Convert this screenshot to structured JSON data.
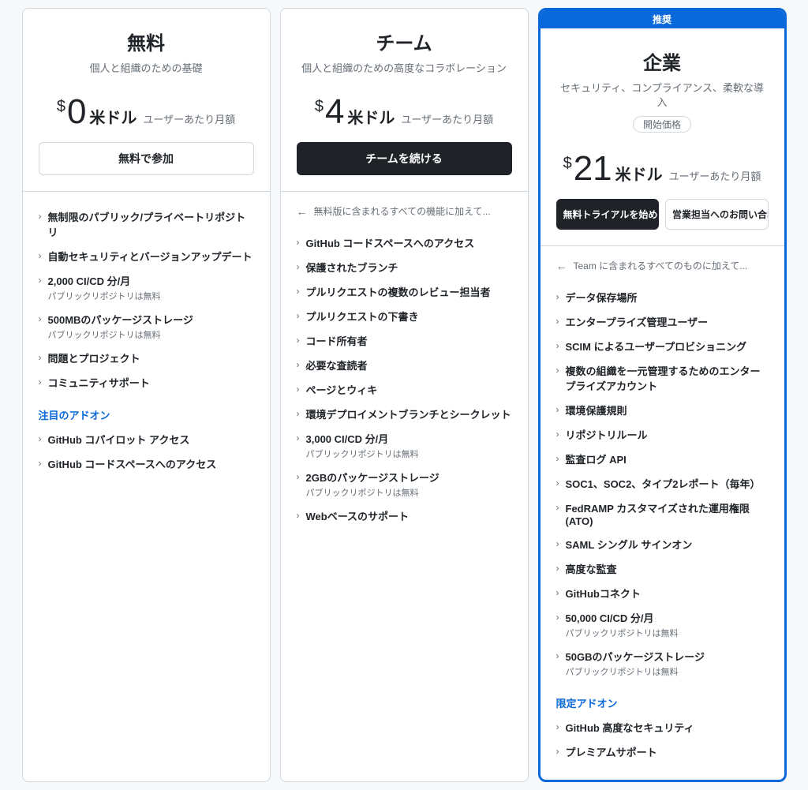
{
  "plans": [
    {
      "name": "無料",
      "desc": "個人と組織のための基礎",
      "price": "0",
      "currency": "米ドル",
      "per": "ユーザーあたり月額",
      "buttons": [
        {
          "label": "無料で参加",
          "style": "light"
        }
      ],
      "inherit": null,
      "features": [
        {
          "main": "無制限のパブリック/プライベートリポジトリ"
        },
        {
          "main": "自動セキュリティとバージョンアップデート"
        },
        {
          "main": "2,000 CI/CD 分/月",
          "sub": "パブリックリポジトリは無料"
        },
        {
          "main": "500MBのパッケージストレージ",
          "sub": "パブリックリポジトリは無料"
        },
        {
          "main": "問題とプロジェクト"
        },
        {
          "main": "コミュニティサポート"
        }
      ],
      "addon_heading": "注目のアドオン",
      "addons": [
        {
          "main": "GitHub コパイロット アクセス"
        },
        {
          "main": "GitHub コードスペースへのアクセス"
        }
      ]
    },
    {
      "name": "チーム",
      "desc": "個人と組織のための高度なコラボレーション",
      "price": "4",
      "currency": "米ドル",
      "per": "ユーザーあたり月額",
      "buttons": [
        {
          "label": "チームを続ける",
          "style": "dark"
        }
      ],
      "inherit": "無料版に含まれるすべての機能に加えて...",
      "features": [
        {
          "main": "GitHub コードスペースへのアクセス"
        },
        {
          "main": "保護されたブランチ"
        },
        {
          "main": "プルリクエストの複数のレビュー担当者"
        },
        {
          "main": "プルリクエストの下書き"
        },
        {
          "main": "コード所有者"
        },
        {
          "main": "必要な査読者"
        },
        {
          "main": "ページとウィキ"
        },
        {
          "main": "環境デプロイメントブランチとシークレット"
        },
        {
          "main": "3,000 CI/CD 分/月",
          "sub": "パブリックリポジトリは無料"
        },
        {
          "main": "2GBのパッケージストレージ",
          "sub": "パブリックリポジトリは無料"
        },
        {
          "main": "Webベースのサポート"
        }
      ],
      "addon_heading": null,
      "addons": []
    },
    {
      "name": "企業",
      "desc": "セキュリティ、コンプライアンス、柔軟な導入",
      "recommended": "推奨",
      "start_price": "開始価格",
      "price": "21",
      "currency": "米ドル",
      "per": "ユーザーあたり月額",
      "buttons": [
        {
          "label": "無料トライアルを始め",
          "style": "dark"
        },
        {
          "label": "営業担当へのお問い合わせ",
          "style": "light"
        }
      ],
      "inherit": "Team に含まれるすべてのものに加えて...",
      "features": [
        {
          "main": "データ保存場所"
        },
        {
          "main": "エンタープライズ管理ユーザー"
        },
        {
          "main": "SCIM によるユーザープロビショニング"
        },
        {
          "main": "複数の組織を一元管理するためのエンタープライズアカウント"
        },
        {
          "main": "環境保護規則"
        },
        {
          "main": "リポジトリルール"
        },
        {
          "main": "監査ログ API"
        },
        {
          "main": "SOC1、SOC2、タイプ2レポート（毎年）"
        },
        {
          "main": "FedRAMP カスタマイズされた運用権限 (ATO)"
        },
        {
          "main": "SAML シングル サインオン"
        },
        {
          "main": "高度な監査"
        },
        {
          "main": "GitHubコネクト"
        },
        {
          "main": "50,000 CI/CD 分/月",
          "sub": "パブリックリポジトリは無料"
        },
        {
          "main": "50GBのパッケージストレージ",
          "sub": "パブリックリポジトリは無料"
        }
      ],
      "addon_heading": "限定アドオン",
      "addons": [
        {
          "main": "GitHub 高度なセキュリティ"
        },
        {
          "main": "プレミアムサポート"
        }
      ]
    }
  ]
}
